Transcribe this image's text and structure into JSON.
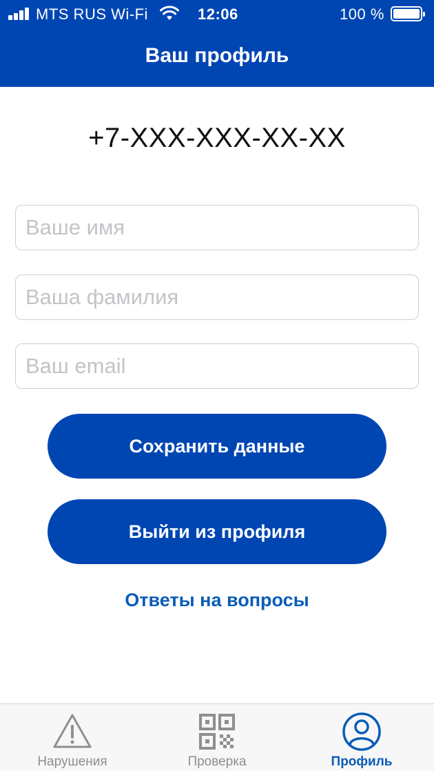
{
  "status_bar": {
    "carrier": "MTS RUS Wi-Fi",
    "time": "12:06",
    "battery": "100 %"
  },
  "header": {
    "title": "Ваш профиль"
  },
  "profile": {
    "phone": "+7-XXX-XXX-XX-XX"
  },
  "form": {
    "name": {
      "placeholder": "Ваше имя",
      "value": ""
    },
    "surname": {
      "placeholder": "Ваша фамилия",
      "value": ""
    },
    "email": {
      "placeholder": "Ваш email",
      "value": ""
    }
  },
  "buttons": {
    "save": "Сохранить данные",
    "logout": "Выйти из профиля"
  },
  "links": {
    "faq": "Ответы на вопросы"
  },
  "tabbar": {
    "items": [
      {
        "label": "Нарушения",
        "icon": "warning-icon",
        "active": false
      },
      {
        "label": "Проверка",
        "icon": "qr-code-icon",
        "active": false
      },
      {
        "label": "Профиль",
        "icon": "profile-icon",
        "active": true
      }
    ]
  },
  "colors": {
    "brand_blue": "#0046b3",
    "link_blue": "#0a5cb8",
    "inactive_gray": "#8e8e93"
  }
}
